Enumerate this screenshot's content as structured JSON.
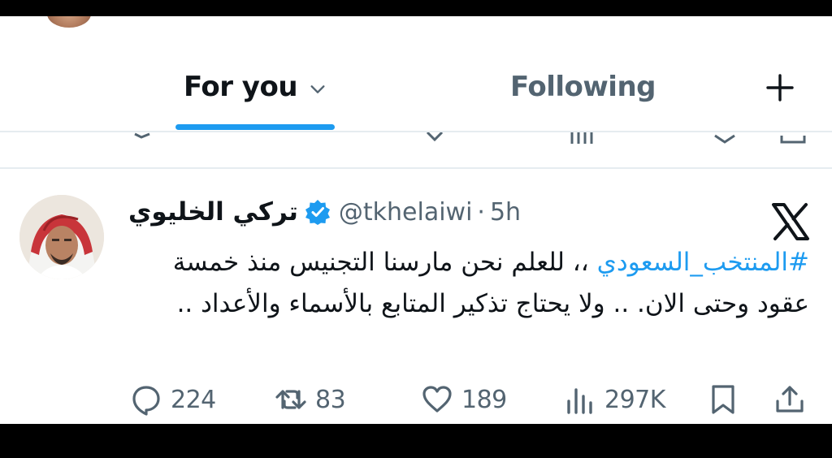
{
  "tabs": {
    "for_you": "For you",
    "following": "Following"
  },
  "post": {
    "author_name": "تركي الخليوي",
    "handle": "@tkhelaiwi",
    "separator": "·",
    "time": "5h",
    "hashtag": "#المنتخب_السعودي",
    "text": " ،، للعلم نحن مارسنا التجنيس منذ خمسة عقود وحتى الان. .. ولا يحتاج تذكير المتابع بالأسماء والأعداد ..",
    "counts": {
      "replies": "224",
      "reposts": "83",
      "likes": "189",
      "views": "297K"
    }
  },
  "icons": {
    "tab_chevron": "chevron-down-icon",
    "compose": "plus-icon",
    "verified": "verified-badge-icon",
    "platform": "x-logo-icon",
    "reply": "reply-icon",
    "repost": "repost-icon",
    "like": "heart-icon",
    "views": "views-icon",
    "bookmark": "bookmark-icon",
    "share": "share-icon"
  },
  "colors": {
    "accent": "#1d9bf0",
    "text_primary": "#0f1419",
    "text_secondary": "#536471",
    "divider": "#e6ecf0",
    "frame": "#000000"
  }
}
